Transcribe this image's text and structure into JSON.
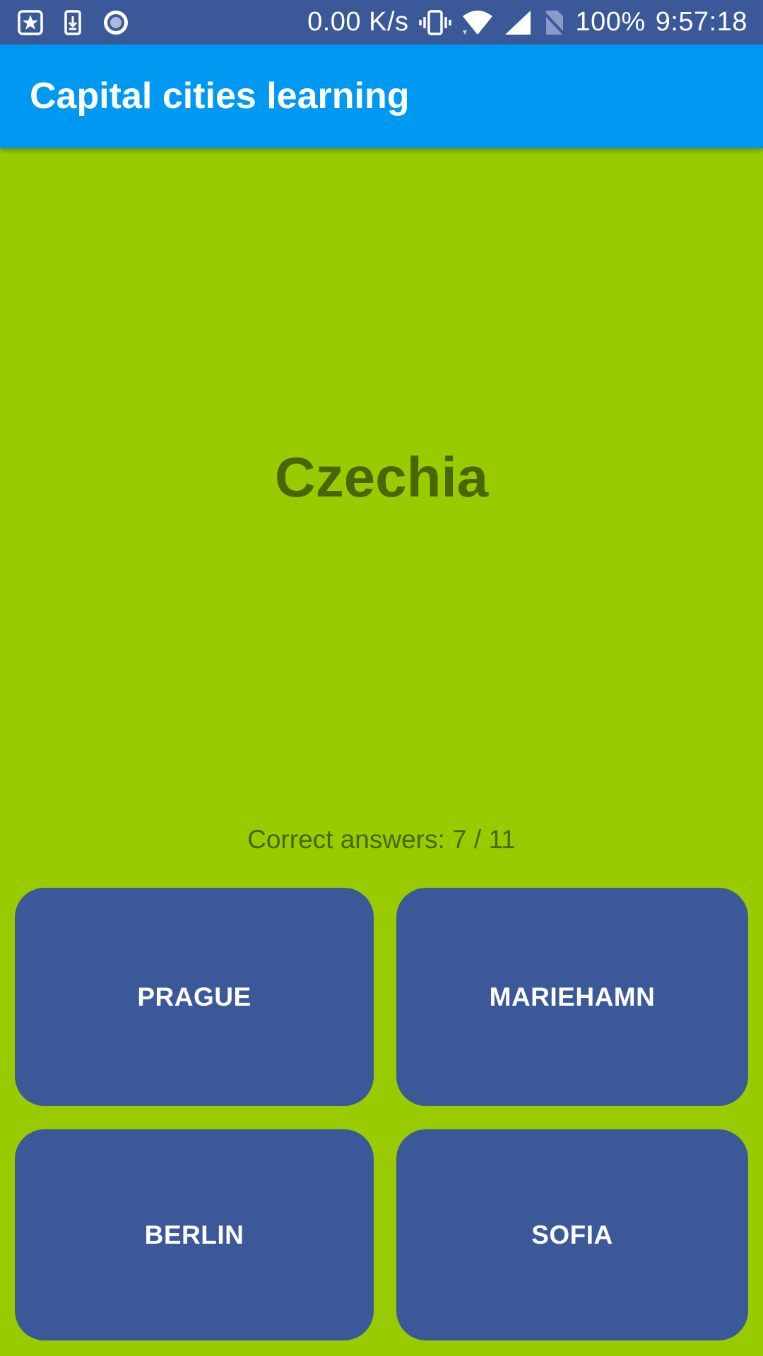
{
  "status_bar": {
    "icons": [
      "star-badge-icon",
      "download-icon",
      "record-icon",
      "vibrate-icon",
      "wifi-icon",
      "signal-icon",
      "no-sim-icon"
    ],
    "network_speed": "0.00 K/s",
    "battery": "100%",
    "time": "9:57:18"
  },
  "app_bar": {
    "title": "Capital cities learning"
  },
  "quiz": {
    "country": "Czechia",
    "score": "Correct answers: 7 / 11",
    "answers": [
      "PRAGUE",
      "MARIEHAMN",
      "BERLIN",
      "SOFIA"
    ]
  },
  "colors": {
    "status_bar": "#3b5998",
    "app_bar": "#0099f2",
    "background": "#99cc00",
    "text_dark": "#4a6600",
    "button": "#3b5998"
  }
}
